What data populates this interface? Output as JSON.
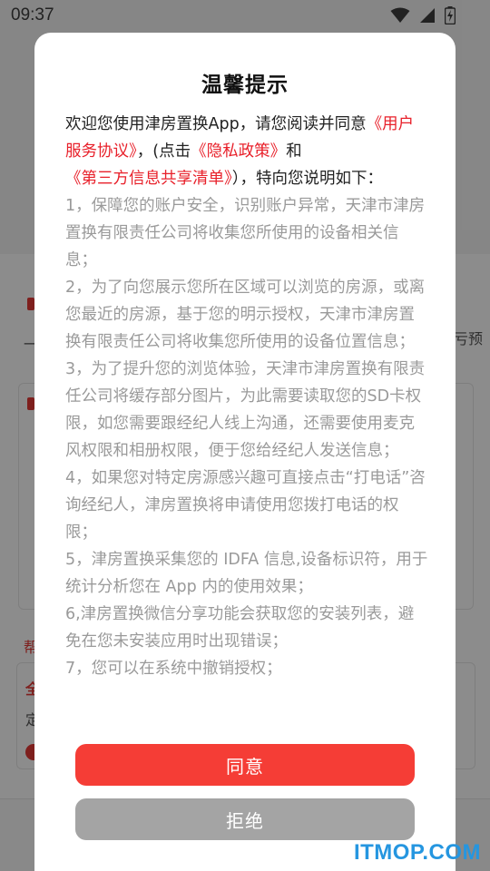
{
  "status_bar": {
    "time": "09:37",
    "icons": [
      "wifi-icon",
      "signal-icon",
      "battery-charging-icon"
    ]
  },
  "background_fragments": {
    "right_text": "亏预",
    "left_char": "一",
    "card_char_1": "全",
    "card_char_2": "定",
    "label_char": "帮"
  },
  "dialog": {
    "title": "温馨提示",
    "intro": {
      "prefix": "欢迎您使用津房置换App，请您阅读并同意",
      "link_user_agreement": "《用户服务协议》",
      "mid_1": "，(点击",
      "link_privacy": "《隐私政策》",
      "mid_2": "和",
      "link_third_party": "《第三方信息共享清单》",
      "suffix": "），特向您说明如下："
    },
    "items": [
      "1，保障您的账户安全，识别账户异常，天津市津房置换有限责任公司将收集您所使用的设备相关信息；",
      "2，为了向您展示您所在区域可以浏览的房源，或离您最近的房源，基于您的明示授权，天津市津房置换有限责任公司将收集您所使用的设备位置信息；",
      "3，为了提升您的浏览体验，天津市津房置换有限责任公司将缓存部分图片，为此需要读取您的SD卡权限，如您需要跟经纪人线上沟通，还需要使用麦克风权限和相册权限，便于您给经纪人发送信息；",
      "4，如果您对特定房源感兴趣可直接点击“打电话”咨询经纪人，津房置换将申请使用您拨打电话的权限；",
      "5，津房置换采集您的 IDFA 信息,设备标识符，用于统计分析您在 App 内的使用效果；",
      "6,津房置换微信分享功能会获取您的安装列表，避免在您未安装应用时出现错误；",
      "7，您可以在系统中撤销授权；"
    ],
    "agree_label": "同意",
    "reject_label": "拒绝"
  },
  "watermark": "ITMOP.COM",
  "colors": {
    "accent_red": "#f53d36",
    "link_red": "#e8202a",
    "reject_gray": "#a4a4a4",
    "watermark_blue": "#2596e0"
  }
}
